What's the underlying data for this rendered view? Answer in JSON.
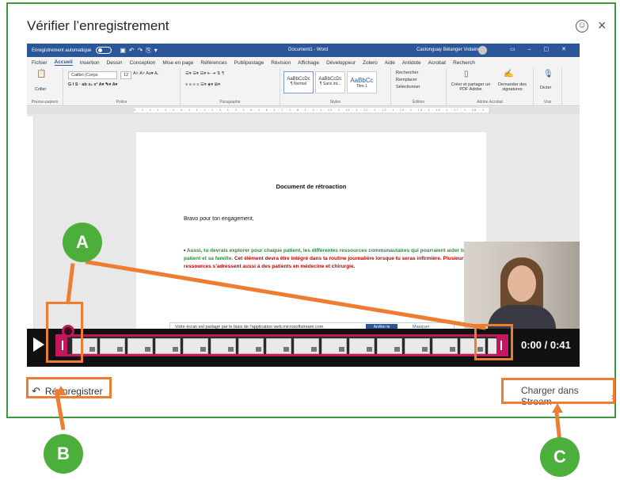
{
  "dialog": {
    "title": "Vérifier l’enregistrement",
    "emoji_icon": "smiley-icon",
    "close_label": "×"
  },
  "word": {
    "autosave_label": "Enregistrement automatique",
    "doc_name": "Document1 - Word",
    "user_name": "Castonguay Bélanger Violaine",
    "menu": [
      "Fichier",
      "Accueil",
      "Insertion",
      "Dessin",
      "Conception",
      "Mise en page",
      "Références",
      "Publipostage",
      "Révision",
      "Affichage",
      "Développeur",
      "Zotero",
      "Aide",
      "Antidote",
      "Acrobat",
      "Recherch"
    ],
    "active_menu": "Accueil",
    "ribbon": {
      "clipboard_label": "Presse-papiers",
      "paste_label": "Coller",
      "font_label": "Police",
      "font_name": "Calibri (Corps",
      "font_size": "12",
      "paragraph_label": "Paragraphe",
      "styles_label": "Styles",
      "style_normal": "¶ Normal",
      "style_nospacing": "¶ Sans int...",
      "style_title1": "Titre 1",
      "style_preview": "AaBbCcDc",
      "style_preview_big": "AaBbCc",
      "edit_label": "Édition",
      "find_label": "Rechercher",
      "replace_label": "Remplacer",
      "select_label": "Sélectionner",
      "adobe_label": "Adobe Acrobat",
      "create_pdf": "Créer et partager un PDF Adobe",
      "request_sig": "Demander des signatures",
      "voice_label": "Voix",
      "dictate": "Dicter"
    },
    "ruler_text": "3 · 1 · 2 · 1 · 1 · 1 · X · 1 · 1 · 2 · 1 · 3 · 1 · 4 · 1 · 5 · 1 · 6 · 1 · 7 · 1 · 8 · 1 · 9 · 1 · 10 · 1 · 11 · 1 · 12 · 1 · 13 · 1 · 14 · 1 · 15 · 1 · 16 · 1 · 17 · 1 · 18 · 1",
    "doc": {
      "title": "Document de rétroaction",
      "greeting": "Bravo pour ton engagement,",
      "bullet_green": "Aussi, tu devrais explorer pour chaque patient, les différentes ressources communautaires qui pourraient aider ton patient et sa famille.",
      "bullet_red": "Cet élément devra être intégré dans ta routine journalière lorsque tu seras infirmière. Plusieurs ressources s’adressent aussi à des patients en médecine et chirurgie."
    },
    "share_bar": {
      "text": "Votre écran est partagé par le biais de l'application web.microsoftstream.com.",
      "stop": "Arrêter le",
      "hide": "Masquer"
    }
  },
  "player": {
    "timecode": "0:00 / 0:41",
    "thumb_count": 16
  },
  "footer": {
    "rerecord_label": "Réenregistrer",
    "upload_label": "Charger dans Stream"
  },
  "annotations": {
    "a": "A",
    "b": "B",
    "c": "C",
    "color": "#ed7d31",
    "badge_color": "#4caf3c"
  }
}
